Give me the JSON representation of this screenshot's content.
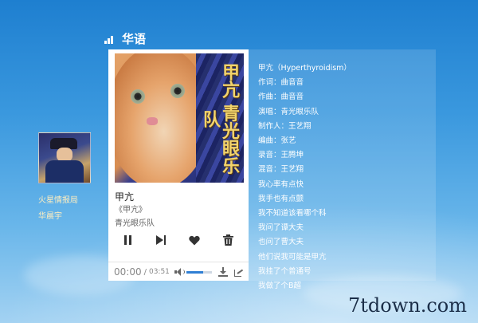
{
  "header": {
    "title": "华语"
  },
  "artist": {
    "line1": "火星情报局",
    "line2": "华晨宇"
  },
  "player": {
    "cover_text": "甲亢 青光眼乐队",
    "song_title": "甲亢",
    "album": "《甲亢》",
    "artist": "青光眼乐队",
    "time_current": "00:00",
    "time_separator": "/",
    "time_total": "03:51",
    "volume_level": 0.65
  },
  "lyrics": [
    "甲亢（Hyperthyroidism）",
    "作词：曲音音",
    "作曲：曲音音",
    "演唱：青光眼乐队",
    "制作人：王艺翔",
    "编曲：张艺",
    "录音：王腾坤",
    "混音：王艺翔",
    "我心率有点快",
    "我手也有点颤",
    "我不知道该看哪个科",
    "我问了谭大夫",
    "也问了曹大夫",
    "他们说我可能是甲亢",
    "我挂了个普通号",
    "我做了个B超"
  ],
  "watermark": "7tdown.com",
  "colors": {
    "accent": "#2f7fd4",
    "sky": "#3a98de"
  }
}
